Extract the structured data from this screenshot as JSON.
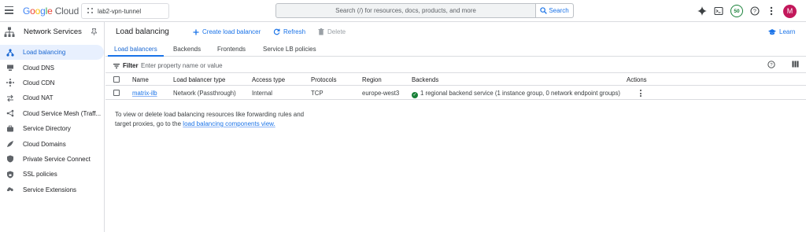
{
  "topbar": {
    "logo": {
      "g": "G",
      "o1": "o",
      "o2": "o",
      "g2": "g",
      "l": "l",
      "e": "e",
      "cloud": "Cloud"
    },
    "project": "lab2-vpn-tunnel",
    "search_placeholder": "Search (/) for resources, docs, products, and more",
    "search_button": "Search",
    "credits_badge": "50",
    "avatar_letter": "M"
  },
  "sidebar": {
    "title": "Network Services",
    "items": [
      {
        "label": "Load balancing",
        "icon": "load-balancing-icon",
        "active": true
      },
      {
        "label": "Cloud DNS",
        "icon": "dns-icon"
      },
      {
        "label": "Cloud CDN",
        "icon": "cdn-icon"
      },
      {
        "label": "Cloud NAT",
        "icon": "nat-icon"
      },
      {
        "label": "Cloud Service Mesh (Traff...",
        "icon": "service-mesh-icon"
      },
      {
        "label": "Service Directory",
        "icon": "service-directory-icon"
      },
      {
        "label": "Cloud Domains",
        "icon": "domains-icon"
      },
      {
        "label": "Private Service Connect",
        "icon": "private-service-connect-icon"
      },
      {
        "label": "SSL policies",
        "icon": "ssl-policy-icon"
      },
      {
        "label": "Service Extensions",
        "icon": "service-extensions-icon"
      }
    ]
  },
  "toolbar": {
    "title": "Load balancing",
    "create": "Create load balancer",
    "refresh": "Refresh",
    "delete": "Delete",
    "learn": "Learn"
  },
  "tabs": [
    "Load balancers",
    "Backends",
    "Frontends",
    "Service LB policies"
  ],
  "filter": {
    "label": "Filter",
    "placeholder": "Enter property name or value"
  },
  "table": {
    "headers": [
      "Name",
      "Load balancer type",
      "Access type",
      "Protocols",
      "Region",
      "Backends",
      "Actions"
    ],
    "rows": [
      {
        "name": "matrix-ilb",
        "type": "Network (Passthrough)",
        "access": "Internal",
        "protocols": "TCP",
        "region": "europe-west3",
        "backends": "1 regional backend service (1 instance group, 0 network endpoint groups)"
      }
    ]
  },
  "info": {
    "text": "To view or delete load balancing resources like forwarding rules and target proxies, go to the",
    "link": "load balancing components view."
  },
  "colors": {
    "accent": "#1a73e8",
    "active_bg": "#e8f0fe",
    "status_ok": "#188038",
    "avatar": "#c2185b"
  }
}
